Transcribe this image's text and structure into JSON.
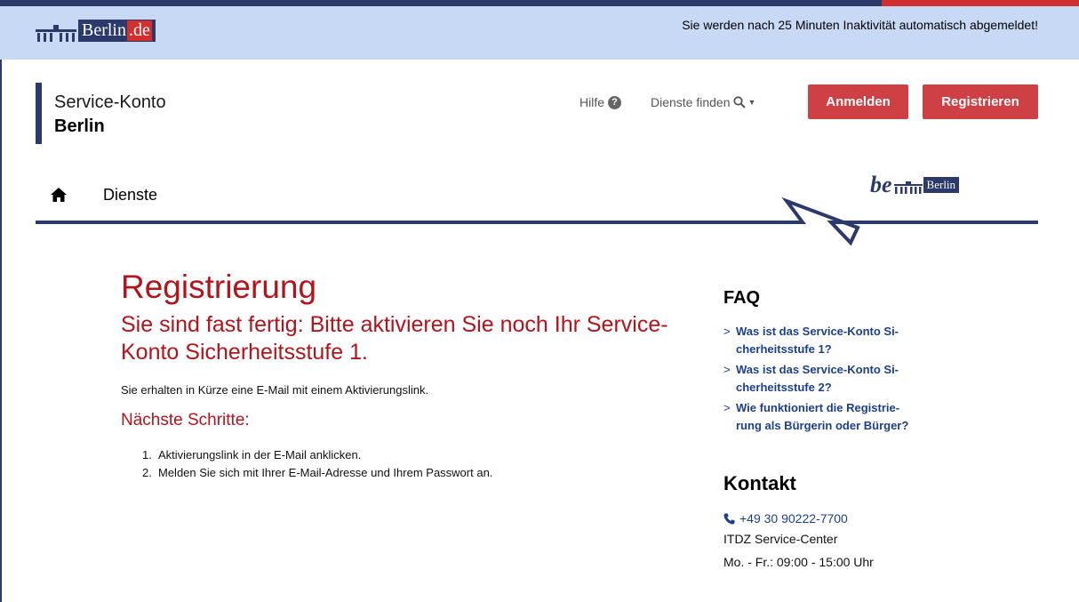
{
  "topbar": {
    "logo_text": "Berlin",
    "logo_tld": ".de",
    "inactivity_notice": "Sie werden nach 25 Minuten Inaktivität automatisch abgemeldet!"
  },
  "brand": {
    "line1": "Service-Konto",
    "line2": "Berlin"
  },
  "header": {
    "help_label": "Hilfe",
    "find_services_label": "Dienste finden",
    "login_label": "Anmelden",
    "register_label": "Registrieren"
  },
  "nav": {
    "services_label": "Dienste",
    "be_logo_be": "be",
    "be_logo_text": "Berlin"
  },
  "main": {
    "title": "Registrierung",
    "subtitle": "Sie sind fast fertig: Bitte aktivieren Sie noch Ihr Service-Konto Sicherheitsstufe 1.",
    "info": "Sie erhalten in Kürze eine E-Mail mit einem Aktivierungslink.",
    "next_steps_title": "Nächste Schritte:",
    "steps": [
      {
        "num": "1.",
        "text": "Aktivierungslink in der E-Mail anklicken."
      },
      {
        "num": "2.",
        "text": "Melden Sie sich mit Ihrer E-Mail-Adresse und Ihrem Passwort an."
      }
    ]
  },
  "sidebar": {
    "faq_title": "FAQ",
    "faq_items": [
      "Was ist das Service-Konto Si-cherheitsstufe 1?",
      "Was ist das Service-Konto Si-cherheitsstufe 2?",
      "Wie funktioniert die Registrie-rung als Bürgerin oder Bürger?"
    ],
    "faq_lines": [
      [
        "Was ist das Service-Konto Si-",
        "cherheitsstufe 1?"
      ],
      [
        "Was ist das Service-Konto Si-",
        "cherheitsstufe 2?"
      ],
      [
        "Wie funktioniert die Registrie-",
        "rung als Bürgerin oder Bürger?"
      ]
    ],
    "contact_title": "Kontakt",
    "phone": "+49 30 90222-7700",
    "contact_name": "ITDZ Service-Center",
    "contact_hours": "Mo. - Fr.: 09:00 - 15:00 Uhr"
  },
  "colors": {
    "navy": "#2b3a6b",
    "red": "#b3141c",
    "button_red": "#cf4045",
    "topbar_bg": "#c8d9f5",
    "link_blue": "#1c3f8c"
  }
}
